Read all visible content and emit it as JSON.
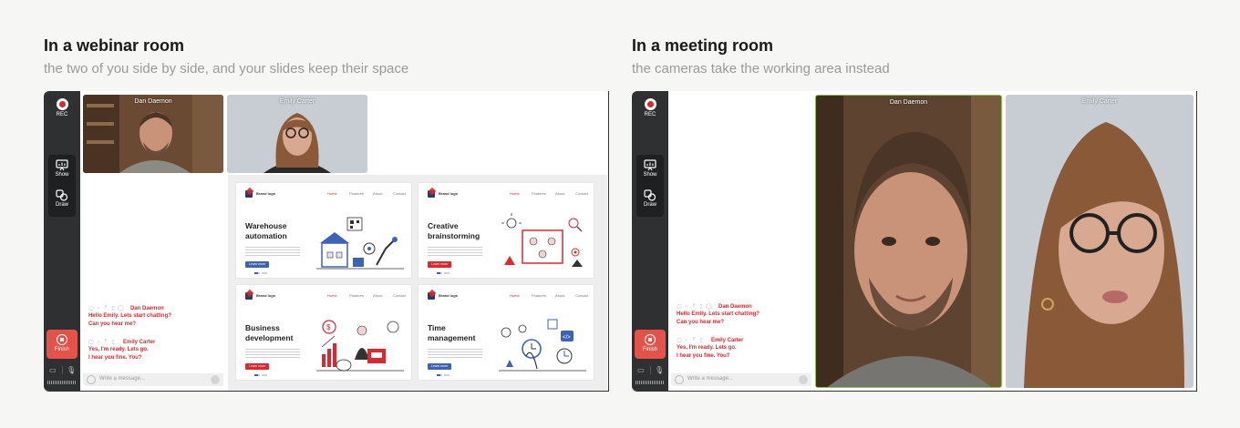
{
  "left_panel": {
    "title": "In a webinar room",
    "subtitle": "the two of you side by side, and your slides keep their space"
  },
  "right_panel": {
    "title": "In a meeting room",
    "subtitle": "the cameras take the working area instead"
  },
  "sidebar": {
    "rec_label": "REC",
    "show_label": "Show",
    "draw_label": "Draw",
    "finish_label": "Finish"
  },
  "participants": [
    {
      "name": "Dan Daemon"
    },
    {
      "name": "Emily Carter"
    }
  ],
  "chat": {
    "messages": [
      {
        "author": "Dan Daemon",
        "lines": [
          "Hello Emily. Lets start chatting?",
          "Can you hear me?"
        ]
      },
      {
        "author": "Emily Carter",
        "lines": [
          "Yes, I'm ready. Lets go.",
          "I hear you fine. You?"
        ]
      }
    ],
    "input_placeholder": "Write a message..."
  },
  "slides": [
    {
      "brand": "Brand logo",
      "nav": [
        "Home",
        "Features",
        "About",
        "Contact"
      ],
      "title_lines": [
        "Warehouse",
        "automation"
      ],
      "button": "Learn more",
      "accent": "#3e63b4"
    },
    {
      "brand": "Brand logo",
      "nav": [
        "Home",
        "Features",
        "About",
        "Contact"
      ],
      "title_lines": [
        "Creative",
        "brainstorming"
      ],
      "button": "Learn more",
      "accent": "#e0262f"
    },
    {
      "brand": "Brand logo",
      "nav": [
        "Home",
        "Features",
        "About",
        "Contact"
      ],
      "title_lines": [
        "Business",
        "development"
      ],
      "button": "Learn more",
      "accent": "#e0262f"
    },
    {
      "brand": "Brand logo",
      "nav": [
        "Home",
        "Features",
        "About",
        "Contact"
      ],
      "title_lines": [
        "Time",
        "management"
      ],
      "button": "Learn more",
      "accent": "#3e63b4"
    }
  ],
  "colors": {
    "accent_red": "#e0262f",
    "sidebar_bg": "#2f3032",
    "finish_bg": "#e3534a"
  }
}
